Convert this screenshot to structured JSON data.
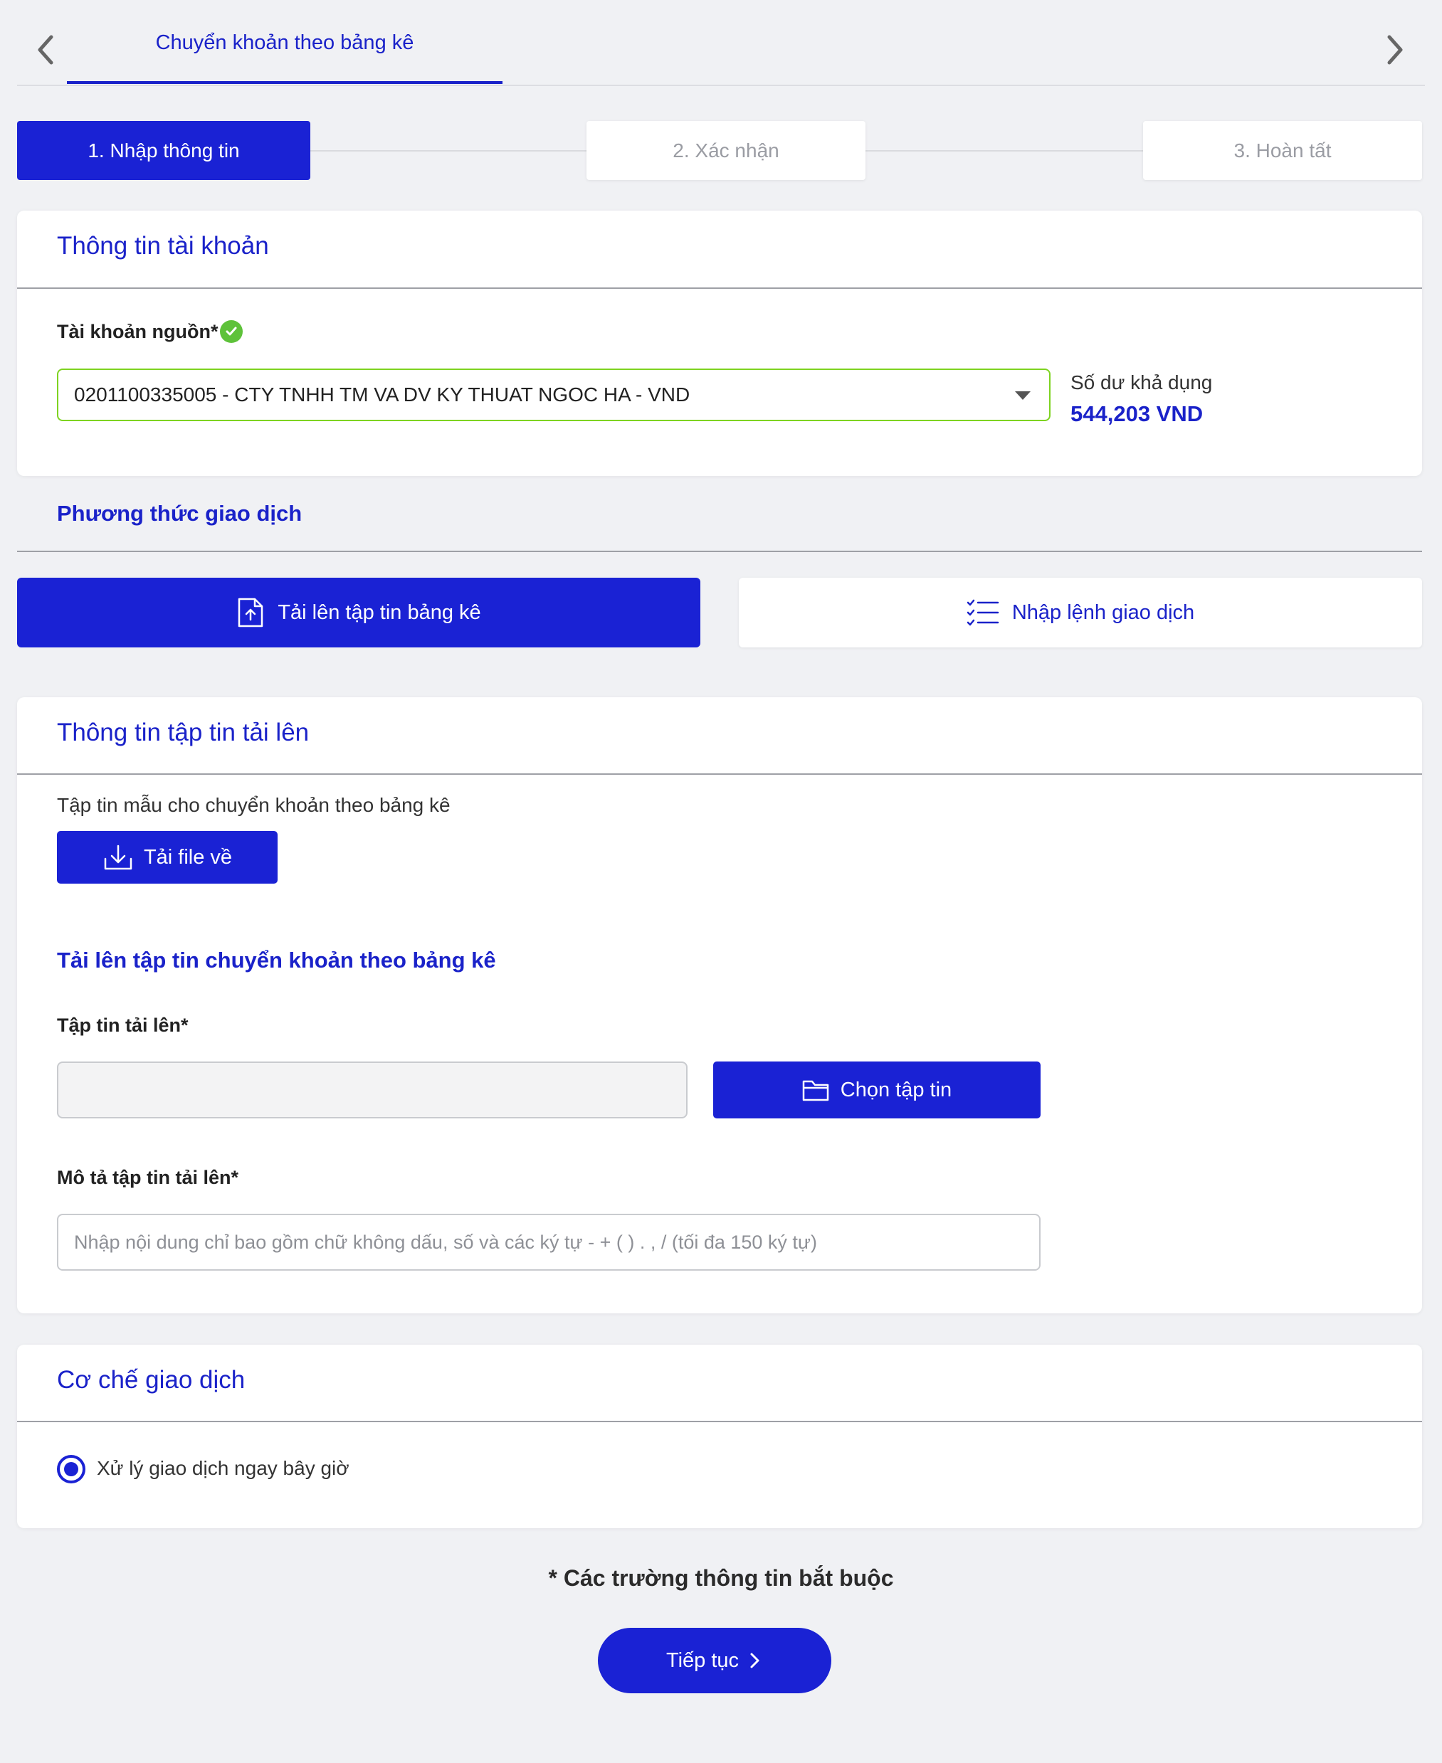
{
  "header": {
    "tab_title": "Chuyển khoản theo bảng kê"
  },
  "stepper": {
    "steps": [
      {
        "label": "1.  Nhập thông tin",
        "state": "active"
      },
      {
        "label": "2.  Xác nhận",
        "state": "inactive"
      },
      {
        "label": "3.  Hoàn tất",
        "state": "inactive"
      }
    ]
  },
  "account_info": {
    "title": "Thông tin tài khoản",
    "source_label": "Tài khoản nguồn*",
    "source_value": "0201100335005 - CTY TNHH TM VA DV KY THUAT NGOC HA - VND",
    "balance_label": "Số dư khả dụng",
    "balance_value": "544,203 VND"
  },
  "method": {
    "title": "Phương thức giao dịch",
    "upload_label": "Tải lên tập tin bảng kê",
    "manual_label": "Nhập lệnh giao dịch",
    "selected": "upload"
  },
  "upload_info": {
    "title": "Thông tin tập tin tải lên",
    "template_text": "Tập tin mẫu cho chuyển khoản theo bảng kê",
    "download_label": "Tải file về",
    "upload_heading": "Tải lên tập tin chuyển khoản theo bảng kê",
    "file_label": "Tập tin tải lên*",
    "file_value": "",
    "choose_label": "Chọn tập tin",
    "desc_label": "Mô tả tập tin tải lên*",
    "desc_placeholder": "Nhập nội dung chỉ bao gồm chữ không dấu, số và các ký tự - + ( ) . , / (tối đa 150 ký tự)"
  },
  "mechanism": {
    "title": "Cơ chế giao dịch",
    "option_label": "Xử lý giao dịch ngay bây giờ",
    "selected": true
  },
  "footer": {
    "required_note": "* Các trường thông tin bắt buộc",
    "continue_label": "Tiếp tục"
  },
  "colors": {
    "primary": "#1a22d4",
    "accent_green": "#7ed321",
    "page_bg": "#f0f1f4"
  }
}
